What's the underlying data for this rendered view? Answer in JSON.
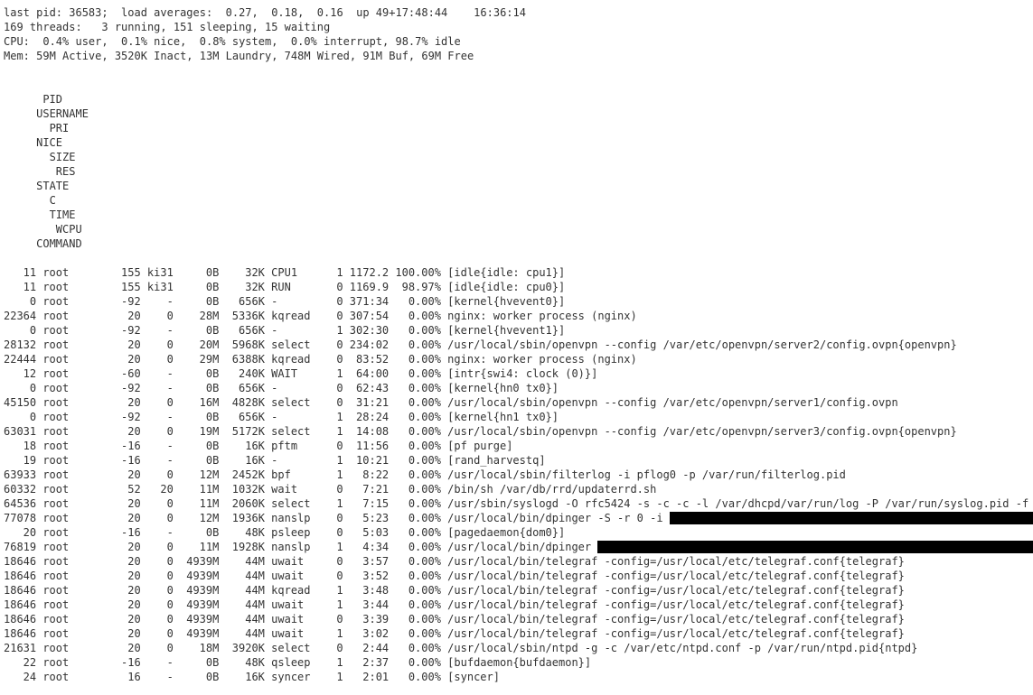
{
  "header": {
    "line1": "last pid: 36583;  load averages:  0.27,  0.18,  0.16  up 49+17:48:44    16:36:14",
    "line2": "169 threads:   3 running, 151 sleeping, 15 waiting",
    "line3": "CPU:  0.4% user,  0.1% nice,  0.8% system,  0.0% interrupt, 98.7% idle",
    "line4": "Mem: 59M Active, 3520K Inact, 13M Laundry, 748M Wired, 91M Buf, 69M Free"
  },
  "columns": {
    "pid": "PID",
    "user": "USERNAME",
    "pri": "PRI",
    "nice": "NICE",
    "size": "SIZE",
    "res": "RES",
    "state": "STATE",
    "c": "C",
    "time": "TIME",
    "wcpu": "WCPU",
    "cmd": "COMMAND"
  },
  "rows": [
    {
      "pid": "11",
      "user": "root",
      "pri": "155",
      "nice": "ki31",
      "size": "0B",
      "res": "32K",
      "state": "CPU1",
      "c": "1",
      "time": "1172.2",
      "wcpu": "100.00%",
      "cmd": "[idle{idle: cpu1}]"
    },
    {
      "pid": "11",
      "user": "root",
      "pri": "155",
      "nice": "ki31",
      "size": "0B",
      "res": "32K",
      "state": "RUN",
      "c": "0",
      "time": "1169.9",
      "wcpu": "98.97%",
      "cmd": "[idle{idle: cpu0}]"
    },
    {
      "pid": "0",
      "user": "root",
      "pri": "-92",
      "nice": "-",
      "size": "0B",
      "res": "656K",
      "state": "-",
      "c": "0",
      "time": "371:34",
      "wcpu": "0.00%",
      "cmd": "[kernel{hvevent0}]"
    },
    {
      "pid": "22364",
      "user": "root",
      "pri": "20",
      "nice": "0",
      "size": "28M",
      "res": "5336K",
      "state": "kqread",
      "c": "0",
      "time": "307:54",
      "wcpu": "0.00%",
      "cmd": "nginx: worker process (nginx)"
    },
    {
      "pid": "0",
      "user": "root",
      "pri": "-92",
      "nice": "-",
      "size": "0B",
      "res": "656K",
      "state": "-",
      "c": "1",
      "time": "302:30",
      "wcpu": "0.00%",
      "cmd": "[kernel{hvevent1}]"
    },
    {
      "pid": "28132",
      "user": "root",
      "pri": "20",
      "nice": "0",
      "size": "20M",
      "res": "5968K",
      "state": "select",
      "c": "0",
      "time": "234:02",
      "wcpu": "0.00%",
      "cmd": "/usr/local/sbin/openvpn --config /var/etc/openvpn/server2/config.ovpn{openvpn}"
    },
    {
      "pid": "22444",
      "user": "root",
      "pri": "20",
      "nice": "0",
      "size": "29M",
      "res": "6388K",
      "state": "kqread",
      "c": "0",
      "time": "83:52",
      "wcpu": "0.00%",
      "cmd": "nginx: worker process (nginx)"
    },
    {
      "pid": "12",
      "user": "root",
      "pri": "-60",
      "nice": "-",
      "size": "0B",
      "res": "240K",
      "state": "WAIT",
      "c": "1",
      "time": "64:00",
      "wcpu": "0.00%",
      "cmd": "[intr{swi4: clock (0)}]"
    },
    {
      "pid": "0",
      "user": "root",
      "pri": "-92",
      "nice": "-",
      "size": "0B",
      "res": "656K",
      "state": "-",
      "c": "0",
      "time": "62:43",
      "wcpu": "0.00%",
      "cmd": "[kernel{hn0 tx0}]"
    },
    {
      "pid": "45150",
      "user": "root",
      "pri": "20",
      "nice": "0",
      "size": "16M",
      "res": "4828K",
      "state": "select",
      "c": "0",
      "time": "31:21",
      "wcpu": "0.00%",
      "cmd": "/usr/local/sbin/openvpn --config /var/etc/openvpn/server1/config.ovpn"
    },
    {
      "pid": "0",
      "user": "root",
      "pri": "-92",
      "nice": "-",
      "size": "0B",
      "res": "656K",
      "state": "-",
      "c": "1",
      "time": "28:24",
      "wcpu": "0.00%",
      "cmd": "[kernel{hn1 tx0}]"
    },
    {
      "pid": "63031",
      "user": "root",
      "pri": "20",
      "nice": "0",
      "size": "19M",
      "res": "5172K",
      "state": "select",
      "c": "1",
      "time": "14:08",
      "wcpu": "0.00%",
      "cmd": "/usr/local/sbin/openvpn --config /var/etc/openvpn/server3/config.ovpn{openvpn}"
    },
    {
      "pid": "18",
      "user": "root",
      "pri": "-16",
      "nice": "-",
      "size": "0B",
      "res": "16K",
      "state": "pftm",
      "c": "0",
      "time": "11:56",
      "wcpu": "0.00%",
      "cmd": "[pf purge]"
    },
    {
      "pid": "19",
      "user": "root",
      "pri": "-16",
      "nice": "-",
      "size": "0B",
      "res": "16K",
      "state": "-",
      "c": "1",
      "time": "10:21",
      "wcpu": "0.00%",
      "cmd": "[rand_harvestq]"
    },
    {
      "pid": "63933",
      "user": "root",
      "pri": "20",
      "nice": "0",
      "size": "12M",
      "res": "2452K",
      "state": "bpf",
      "c": "1",
      "time": "8:22",
      "wcpu": "0.00%",
      "cmd": "/usr/local/sbin/filterlog -i pflog0 -p /var/run/filterlog.pid"
    },
    {
      "pid": "60332",
      "user": "root",
      "pri": "52",
      "nice": "20",
      "size": "11M",
      "res": "1032K",
      "state": "wait",
      "c": "0",
      "time": "7:21",
      "wcpu": "0.00%",
      "cmd": "/bin/sh /var/db/rrd/updaterrd.sh"
    },
    {
      "pid": "64536",
      "user": "root",
      "pri": "20",
      "nice": "0",
      "size": "11M",
      "res": "2060K",
      "state": "select",
      "c": "1",
      "time": "7:15",
      "wcpu": "0.00%",
      "cmd": "/usr/sbin/syslogd -O rfc5424 -s -c -c -l /var/dhcpd/var/run/log -P /var/run/syslog.pid -f "
    },
    {
      "pid": "77078",
      "user": "root",
      "pri": "20",
      "nice": "0",
      "size": "12M",
      "res": "1936K",
      "state": "nanslp",
      "c": "0",
      "time": "5:23",
      "wcpu": "0.00%",
      "cmd": "/usr/local/bin/dpinger -S -r 0 -i ",
      "redact_after_cmd": 57
    },
    {
      "pid": "20",
      "user": "root",
      "pri": "-16",
      "nice": "-",
      "size": "0B",
      "res": "48K",
      "state": "psleep",
      "c": "0",
      "time": "5:03",
      "wcpu": "0.00%",
      "cmd": "[pagedaemon{dom0}]"
    },
    {
      "pid": "76819",
      "user": "root",
      "pri": "20",
      "nice": "0",
      "size": "11M",
      "res": "1928K",
      "state": "nanslp",
      "c": "1",
      "time": "4:34",
      "wcpu": "0.00%",
      "cmd": "/usr/local/bin/dpinger ",
      "redact_after_cmd": 70
    },
    {
      "pid": "18646",
      "user": "root",
      "pri": "20",
      "nice": "0",
      "size": "4939M",
      "res": "44M",
      "state": "uwait",
      "c": "0",
      "time": "3:57",
      "wcpu": "0.00%",
      "cmd": "/usr/local/bin/telegraf -config=/usr/local/etc/telegraf.conf{telegraf}"
    },
    {
      "pid": "18646",
      "user": "root",
      "pri": "20",
      "nice": "0",
      "size": "4939M",
      "res": "44M",
      "state": "uwait",
      "c": "0",
      "time": "3:52",
      "wcpu": "0.00%",
      "cmd": "/usr/local/bin/telegraf -config=/usr/local/etc/telegraf.conf{telegraf}"
    },
    {
      "pid": "18646",
      "user": "root",
      "pri": "20",
      "nice": "0",
      "size": "4939M",
      "res": "44M",
      "state": "kqread",
      "c": "1",
      "time": "3:48",
      "wcpu": "0.00%",
      "cmd": "/usr/local/bin/telegraf -config=/usr/local/etc/telegraf.conf{telegraf}"
    },
    {
      "pid": "18646",
      "user": "root",
      "pri": "20",
      "nice": "0",
      "size": "4939M",
      "res": "44M",
      "state": "uwait",
      "c": "1",
      "time": "3:44",
      "wcpu": "0.00%",
      "cmd": "/usr/local/bin/telegraf -config=/usr/local/etc/telegraf.conf{telegraf}"
    },
    {
      "pid": "18646",
      "user": "root",
      "pri": "20",
      "nice": "0",
      "size": "4939M",
      "res": "44M",
      "state": "uwait",
      "c": "0",
      "time": "3:39",
      "wcpu": "0.00%",
      "cmd": "/usr/local/bin/telegraf -config=/usr/local/etc/telegraf.conf{telegraf}"
    },
    {
      "pid": "18646",
      "user": "root",
      "pri": "20",
      "nice": "0",
      "size": "4939M",
      "res": "44M",
      "state": "uwait",
      "c": "1",
      "time": "3:02",
      "wcpu": "0.00%",
      "cmd": "/usr/local/bin/telegraf -config=/usr/local/etc/telegraf.conf{telegraf}"
    },
    {
      "pid": "21631",
      "user": "root",
      "pri": "20",
      "nice": "0",
      "size": "18M",
      "res": "3920K",
      "state": "select",
      "c": "0",
      "time": "2:44",
      "wcpu": "0.00%",
      "cmd": "/usr/local/sbin/ntpd -g -c /var/etc/ntpd.conf -p /var/run/ntpd.pid{ntpd}"
    },
    {
      "pid": "22",
      "user": "root",
      "pri": "-16",
      "nice": "-",
      "size": "0B",
      "res": "48K",
      "state": "qsleep",
      "c": "1",
      "time": "2:37",
      "wcpu": "0.00%",
      "cmd": "[bufdaemon{bufdaemon}]"
    },
    {
      "pid": "24",
      "user": "root",
      "pri": "16",
      "nice": "-",
      "size": "0B",
      "res": "16K",
      "state": "syncer",
      "c": "1",
      "time": "2:01",
      "wcpu": "0.00%",
      "cmd": "[syncer]"
    }
  ]
}
